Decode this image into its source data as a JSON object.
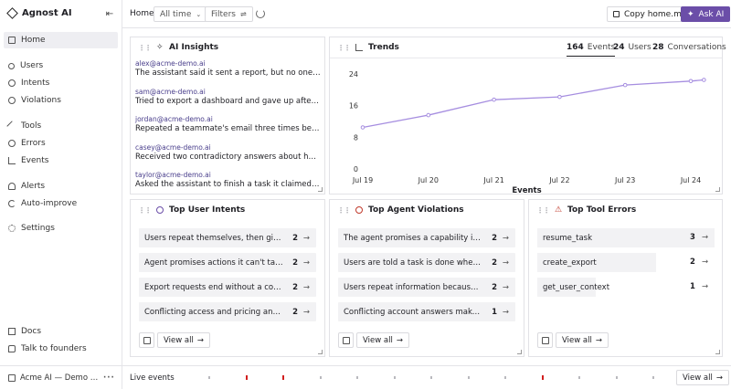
{
  "app": {
    "name": "Agnost AI"
  },
  "sidebar": {
    "items": [
      {
        "label": "Home",
        "icon": "home-icon"
      },
      {
        "label": "Users",
        "icon": "users-icon"
      },
      {
        "label": "Intents",
        "icon": "intents-icon"
      },
      {
        "label": "Violations",
        "icon": "violations-icon"
      },
      {
        "label": "Tools",
        "icon": "tools-icon"
      },
      {
        "label": "Errors",
        "icon": "errors-icon"
      },
      {
        "label": "Events",
        "icon": "events-icon"
      },
      {
        "label": "Alerts",
        "icon": "alerts-icon"
      },
      {
        "label": "Auto-improve",
        "icon": "auto-improve-icon"
      },
      {
        "label": "Settings",
        "icon": "settings-icon"
      },
      {
        "label": "Docs",
        "icon": "docs-icon"
      },
      {
        "label": "Talk to founders",
        "icon": "chat-icon"
      }
    ],
    "workspace": "Acme AI — Demo Workspace"
  },
  "topbar": {
    "breadcrumb": "Home",
    "time_range": "All time",
    "filters": "Filters",
    "copy_label": "Copy home.md",
    "ask_label": "Ask AI"
  },
  "insights": {
    "title": "AI Insights",
    "items": [
      {
        "email": "alex@acme-demo.ai",
        "text": "The assistant said it sent a report, but no one on the team received it"
      },
      {
        "email": "sam@acme-demo.ai",
        "text": "Tried to export a dashboard and gave up after the progress bar stalled"
      },
      {
        "email": "jordan@acme-demo.ai",
        "text": "Repeated a teammate's email three times because the agent kept forgetting"
      },
      {
        "email": "casey@acme-demo.ai",
        "text": "Received two contradictory answers about how many seats are included"
      },
      {
        "email": "taylor@acme-demo.ai",
        "text": "Asked the assistant to finish a task it claimed was already complete"
      }
    ]
  },
  "trends": {
    "title": "Trends",
    "stats": [
      {
        "value": "164",
        "label": "Events"
      },
      {
        "value": "24",
        "label": "Users"
      },
      {
        "value": "28",
        "label": "Conversations"
      }
    ]
  },
  "chart_data": {
    "type": "line",
    "x": [
      "Jul 19",
      "Jul 20",
      "Jul 21",
      "Jul 22",
      "Jul 23",
      "Jul 24"
    ],
    "x_tick_labels": [
      "Jul 19",
      "Jul 20",
      "Jul 21",
      "Jul 22",
      "Jul 23",
      "Jul 24"
    ],
    "y_ticks": [
      "24",
      "16",
      "8",
      "0"
    ],
    "series": [
      {
        "values": [
          10.5,
          13.6,
          17.5,
          18.2,
          21.2,
          22.2,
          22.5
        ]
      }
    ],
    "point_days": [
      19,
      20,
      21,
      22,
      23,
      24,
      24.2
    ],
    "xlabel": "Events",
    "ylim": [
      0,
      24
    ],
    "color": "#a68ee0",
    "grid": false
  },
  "intents": {
    "title": "Top User Intents",
    "rows": [
      {
        "label": "Users repeat themselves, then give up",
        "count": "2"
      },
      {
        "label": "Agent promises actions it can't take",
        "count": "2"
      },
      {
        "label": "Export requests end without a completed file",
        "count": "2"
      },
      {
        "label": "Conflicting access and pricing answers",
        "count": "2"
      }
    ],
    "view_all": "View all"
  },
  "violations": {
    "title": "Top Agent Violations",
    "rows": [
      {
        "label": "The agent promises a capability it can't deliver",
        "count": "2"
      },
      {
        "label": "Users are told a task is done when it isn't",
        "count": "2"
      },
      {
        "label": "Users repeat information because the agent forgets",
        "count": "2"
      },
      {
        "label": "Conflicting account answers make users doubt",
        "count": "1"
      }
    ],
    "view_all": "View all"
  },
  "tool_errors": {
    "title": "Top Tool Errors",
    "rows": [
      {
        "label": "resume_task",
        "count": "3",
        "share": 1.0
      },
      {
        "label": "create_export",
        "count": "2",
        "share": 0.67
      },
      {
        "label": "get_user_context",
        "count": "1",
        "share": 0.33
      }
    ],
    "view_all": "View all"
  },
  "live_events": {
    "label": "Live events",
    "view_all": "View all",
    "ticks": [
      "gray",
      "red",
      "red",
      "gray",
      "gray",
      "gray",
      "gray",
      "gray",
      "gray",
      "red",
      "gray",
      "gray",
      "gray",
      "red",
      "gray"
    ],
    "colors": {
      "gray": "#b9b9be",
      "red": "#d21f1f"
    }
  },
  "colors": {
    "accent": "#6b4ea8",
    "chart_line": "#a68ee0"
  }
}
